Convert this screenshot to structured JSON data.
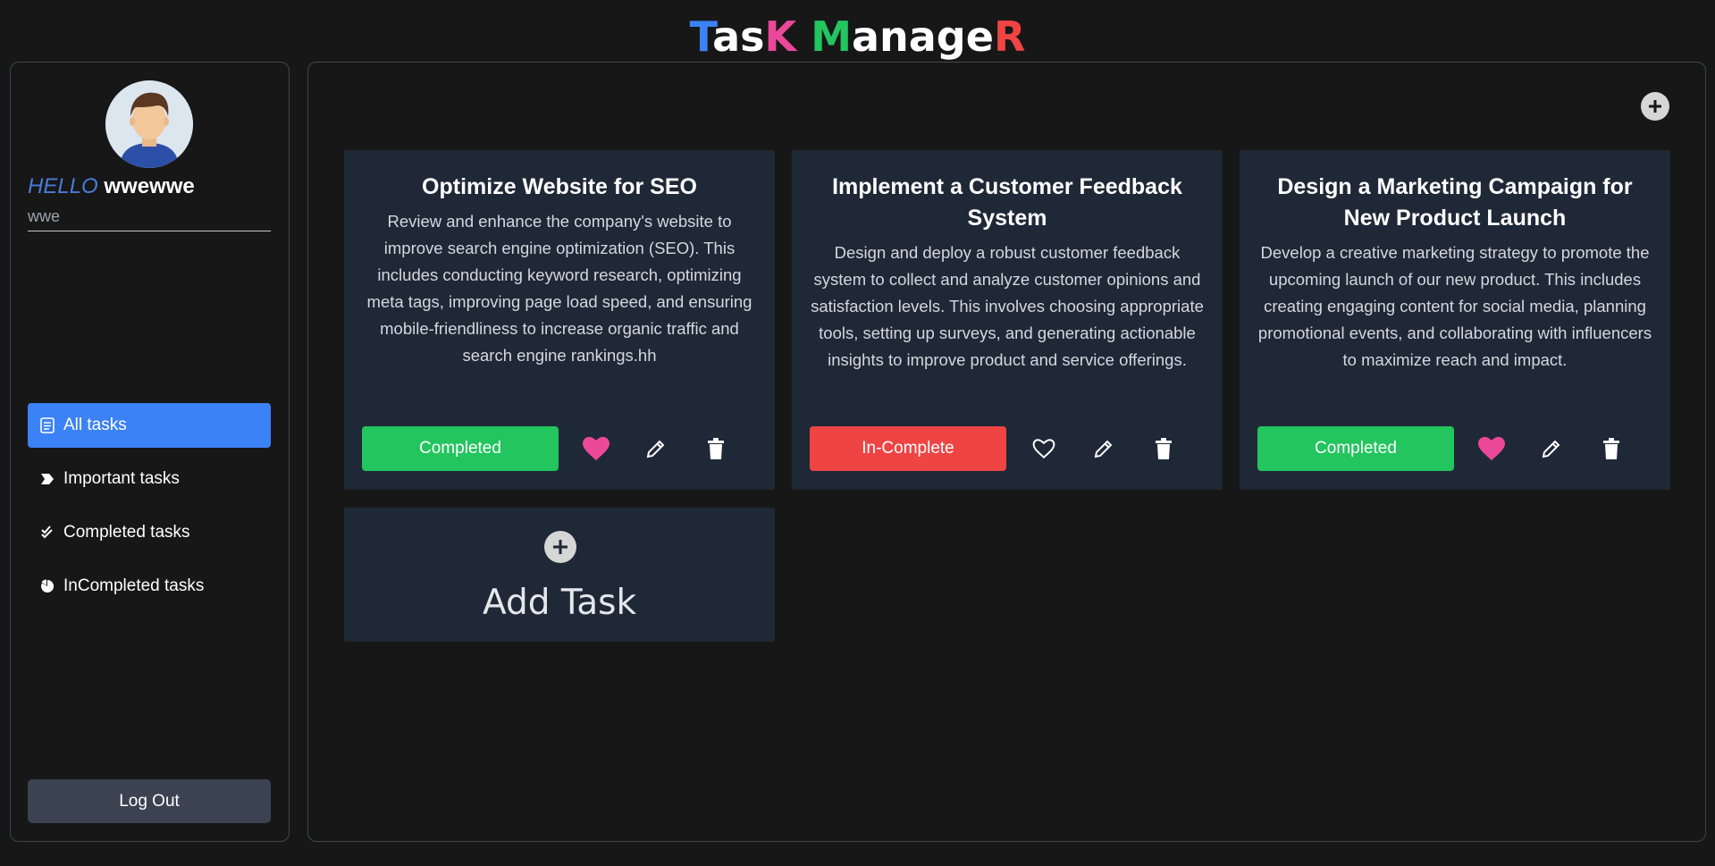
{
  "app_title": {
    "letters": [
      {
        "ch": "T",
        "color": "#3b82f6"
      },
      {
        "ch": "as",
        "color": "#ffffff"
      },
      {
        "ch": "K",
        "color": "#ec4899"
      },
      {
        "ch": " ",
        "color": "#ffffff"
      },
      {
        "ch": "M",
        "color": "#22c55e"
      },
      {
        "ch": "anage",
        "color": "#ffffff"
      },
      {
        "ch": "R",
        "color": "#ef4444"
      }
    ]
  },
  "user": {
    "greeting": "HELLO",
    "name": "wwewwe",
    "email": "wwe"
  },
  "sidebar": {
    "items": [
      {
        "label": "All tasks",
        "icon": "list-icon",
        "active": true
      },
      {
        "label": "Important tasks",
        "icon": "tag-icon",
        "active": false
      },
      {
        "label": "Completed tasks",
        "icon": "double-check-icon",
        "active": false
      },
      {
        "label": "InCompleted tasks",
        "icon": "pie-icon",
        "active": false
      }
    ],
    "logout_label": "Log Out"
  },
  "tasks": [
    {
      "title": "Optimize Website for SEO",
      "description": "Review and enhance the company's website to improve search engine optimization (SEO). This includes conducting keyword research, optimizing meta tags, improving page load speed, and ensuring mobile-friendliness to increase organic traffic and search engine rankings.hh",
      "status_label": "Completed",
      "status_color": "#22c55e",
      "important": true
    },
    {
      "title": "Implement a Customer Feedback System",
      "description": "Design and deploy a robust customer feedback system to collect and analyze customer opinions and satisfaction levels. This involves choosing appropriate tools, setting up surveys, and generating actionable insights to improve product and service offerings.",
      "status_label": "In-Complete",
      "status_color": "#ef4444",
      "important": false
    },
    {
      "title": "Design a Marketing Campaign for New Product Launch",
      "description": "Develop a creative marketing strategy to promote the upcoming launch of our new product. This includes creating engaging content for social media, planning promotional events, and collaborating with influencers to maximize reach and impact.",
      "status_label": "Completed",
      "status_color": "#22c55e",
      "important": true
    }
  ],
  "add_task_label": "Add Task",
  "colors": {
    "heart_active": "#ec4899",
    "accent": "#3b82f6"
  }
}
